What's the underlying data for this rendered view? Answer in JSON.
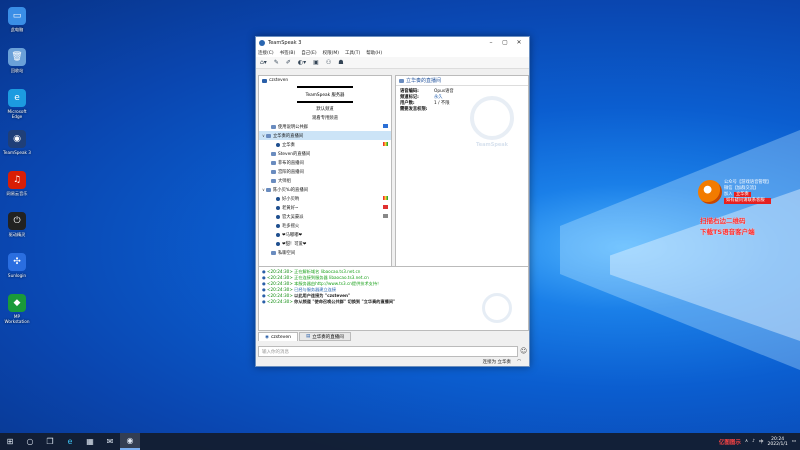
{
  "desktop": {
    "icons": [
      {
        "label": "此电脑",
        "color": "#3a8ee6",
        "glyph": "▭"
      },
      {
        "label": "回收站",
        "color": "#6aa0d8",
        "glyph": "🗑"
      },
      {
        "label": "Microsoft Edge",
        "color": "#1c9be0",
        "glyph": "e"
      },
      {
        "label": "TeamSpeak 3",
        "color": "#1f3f78",
        "glyph": "◉"
      },
      {
        "label": "网易云音乐",
        "color": "#d81e06",
        "glyph": "♫"
      },
      {
        "label": "驱动精灵",
        "color": "#222222",
        "glyph": "⏻"
      },
      {
        "label": "Sunlogin",
        "color": "#2a6ee0",
        "glyph": "✣"
      },
      {
        "label": "MP Workstation",
        "color": "#1a9a3a",
        "glyph": "◆"
      }
    ]
  },
  "window": {
    "title": "TeamSpeak 3",
    "menu": [
      "连接(C)",
      "书签(B)",
      "自己(E)",
      "权限(M)",
      "工具(T)",
      "帮助(H)"
    ],
    "server": {
      "name": "czsteven",
      "banner": "TeamSpeak 服务器",
      "sub1": "默认频道",
      "sub2": "观看专用频道"
    },
    "tree": [
      {
        "type": "chan",
        "label": "使用说明公共群",
        "indent": 1,
        "arrow": "",
        "flag": "blue"
      },
      {
        "type": "chan",
        "label": "立华奏的直播间",
        "indent": 0,
        "arrow": "∨",
        "sel": true
      },
      {
        "type": "user",
        "label": "立华奏",
        "indent": 2,
        "flag": "multi"
      },
      {
        "type": "chan",
        "label": "Steven的直播间",
        "indent": 1
      },
      {
        "type": "chan",
        "label": "菲布的直播间",
        "indent": 1
      },
      {
        "type": "chan",
        "label": "宫阳的直播间",
        "indent": 1
      },
      {
        "type": "chan",
        "label": "大师组",
        "indent": 1
      },
      {
        "type": "chan",
        "label": "陈小贝Yu的直播间",
        "indent": 0,
        "arrow": "∨"
      },
      {
        "type": "user",
        "label": "好小贝哟",
        "indent": 2,
        "flag": "multi"
      },
      {
        "type": "user",
        "label": "老黄好~",
        "indent": 2,
        "flag": "red"
      },
      {
        "type": "user",
        "label": "官大吴豪派",
        "indent": 2,
        "flag": "gray"
      },
      {
        "type": "user",
        "label": "毛多摇火",
        "indent": 2
      },
      {
        "type": "user",
        "label": "❤马嘟嘟❤",
        "indent": 2
      },
      {
        "type": "user",
        "label": "❤甜！可爱❤",
        "indent": 2
      },
      {
        "type": "chan",
        "label": "私聊空间",
        "indent": 1
      }
    ],
    "info": {
      "channel_title": "立华奏的直播间",
      "rows": [
        {
          "k": "语音编码:",
          "v": "Opus语音",
          "blue": false
        },
        {
          "k": "频道标记:",
          "v": "永久",
          "blue": true
        },
        {
          "k": "用户数:",
          "v": "1 / 不限",
          "blue": false
        },
        {
          "k": "需要发言权限:",
          "v": "",
          "blue": false
        }
      ],
      "watermark": "TeamSpeak"
    },
    "chat": [
      {
        "ts": "<20:24:30>",
        "text": "正在解析域名 libaocao.ts3.net.cn",
        "cls": "green"
      },
      {
        "ts": "<20:24:30>",
        "text": "正在连接到服务器 libaocao.ts3.net.cn",
        "cls": "green"
      },
      {
        "ts": "<20:24:30>",
        "text": "本服务器由http://www.ts3.cn提供技术支持！",
        "cls": "green"
      },
      {
        "ts": "<20:24:30>",
        "text": "已经与服务器建立连接",
        "cls": "blue"
      },
      {
        "ts": "<20:24:30>",
        "text": "以此用户连接为 \"czsteven\"",
        "cls": "dark"
      },
      {
        "ts": "<20:24:30>",
        "text": "你从频道 \"使命召唤公共群\" 切换到 \"立华奏的直播间\"",
        "cls": "dark"
      }
    ],
    "tabs": [
      "czsteven",
      "立华奏的直播间"
    ],
    "input_placeholder": "输入你的消息",
    "status": "连接为 立华奏"
  },
  "overlay": {
    "line1": "公众号【游戏语音管理】",
    "line2": "微信【加群交流】",
    "line3": "加入",
    "line3_box": "立华奏",
    "line4": "如有疑问请联系客服",
    "red1": "扫描右边二维码",
    "red2": "下载TS语音客户端"
  },
  "taskbar": {
    "watermark": "亿图图示",
    "lang": "中",
    "time": "20:24",
    "date": "2022/1/1"
  },
  "colors": {
    "accent": "#1d4f9a",
    "selection": "#cce4f7",
    "chat_green": "#18a018",
    "red_text": "#ff2a2a"
  }
}
